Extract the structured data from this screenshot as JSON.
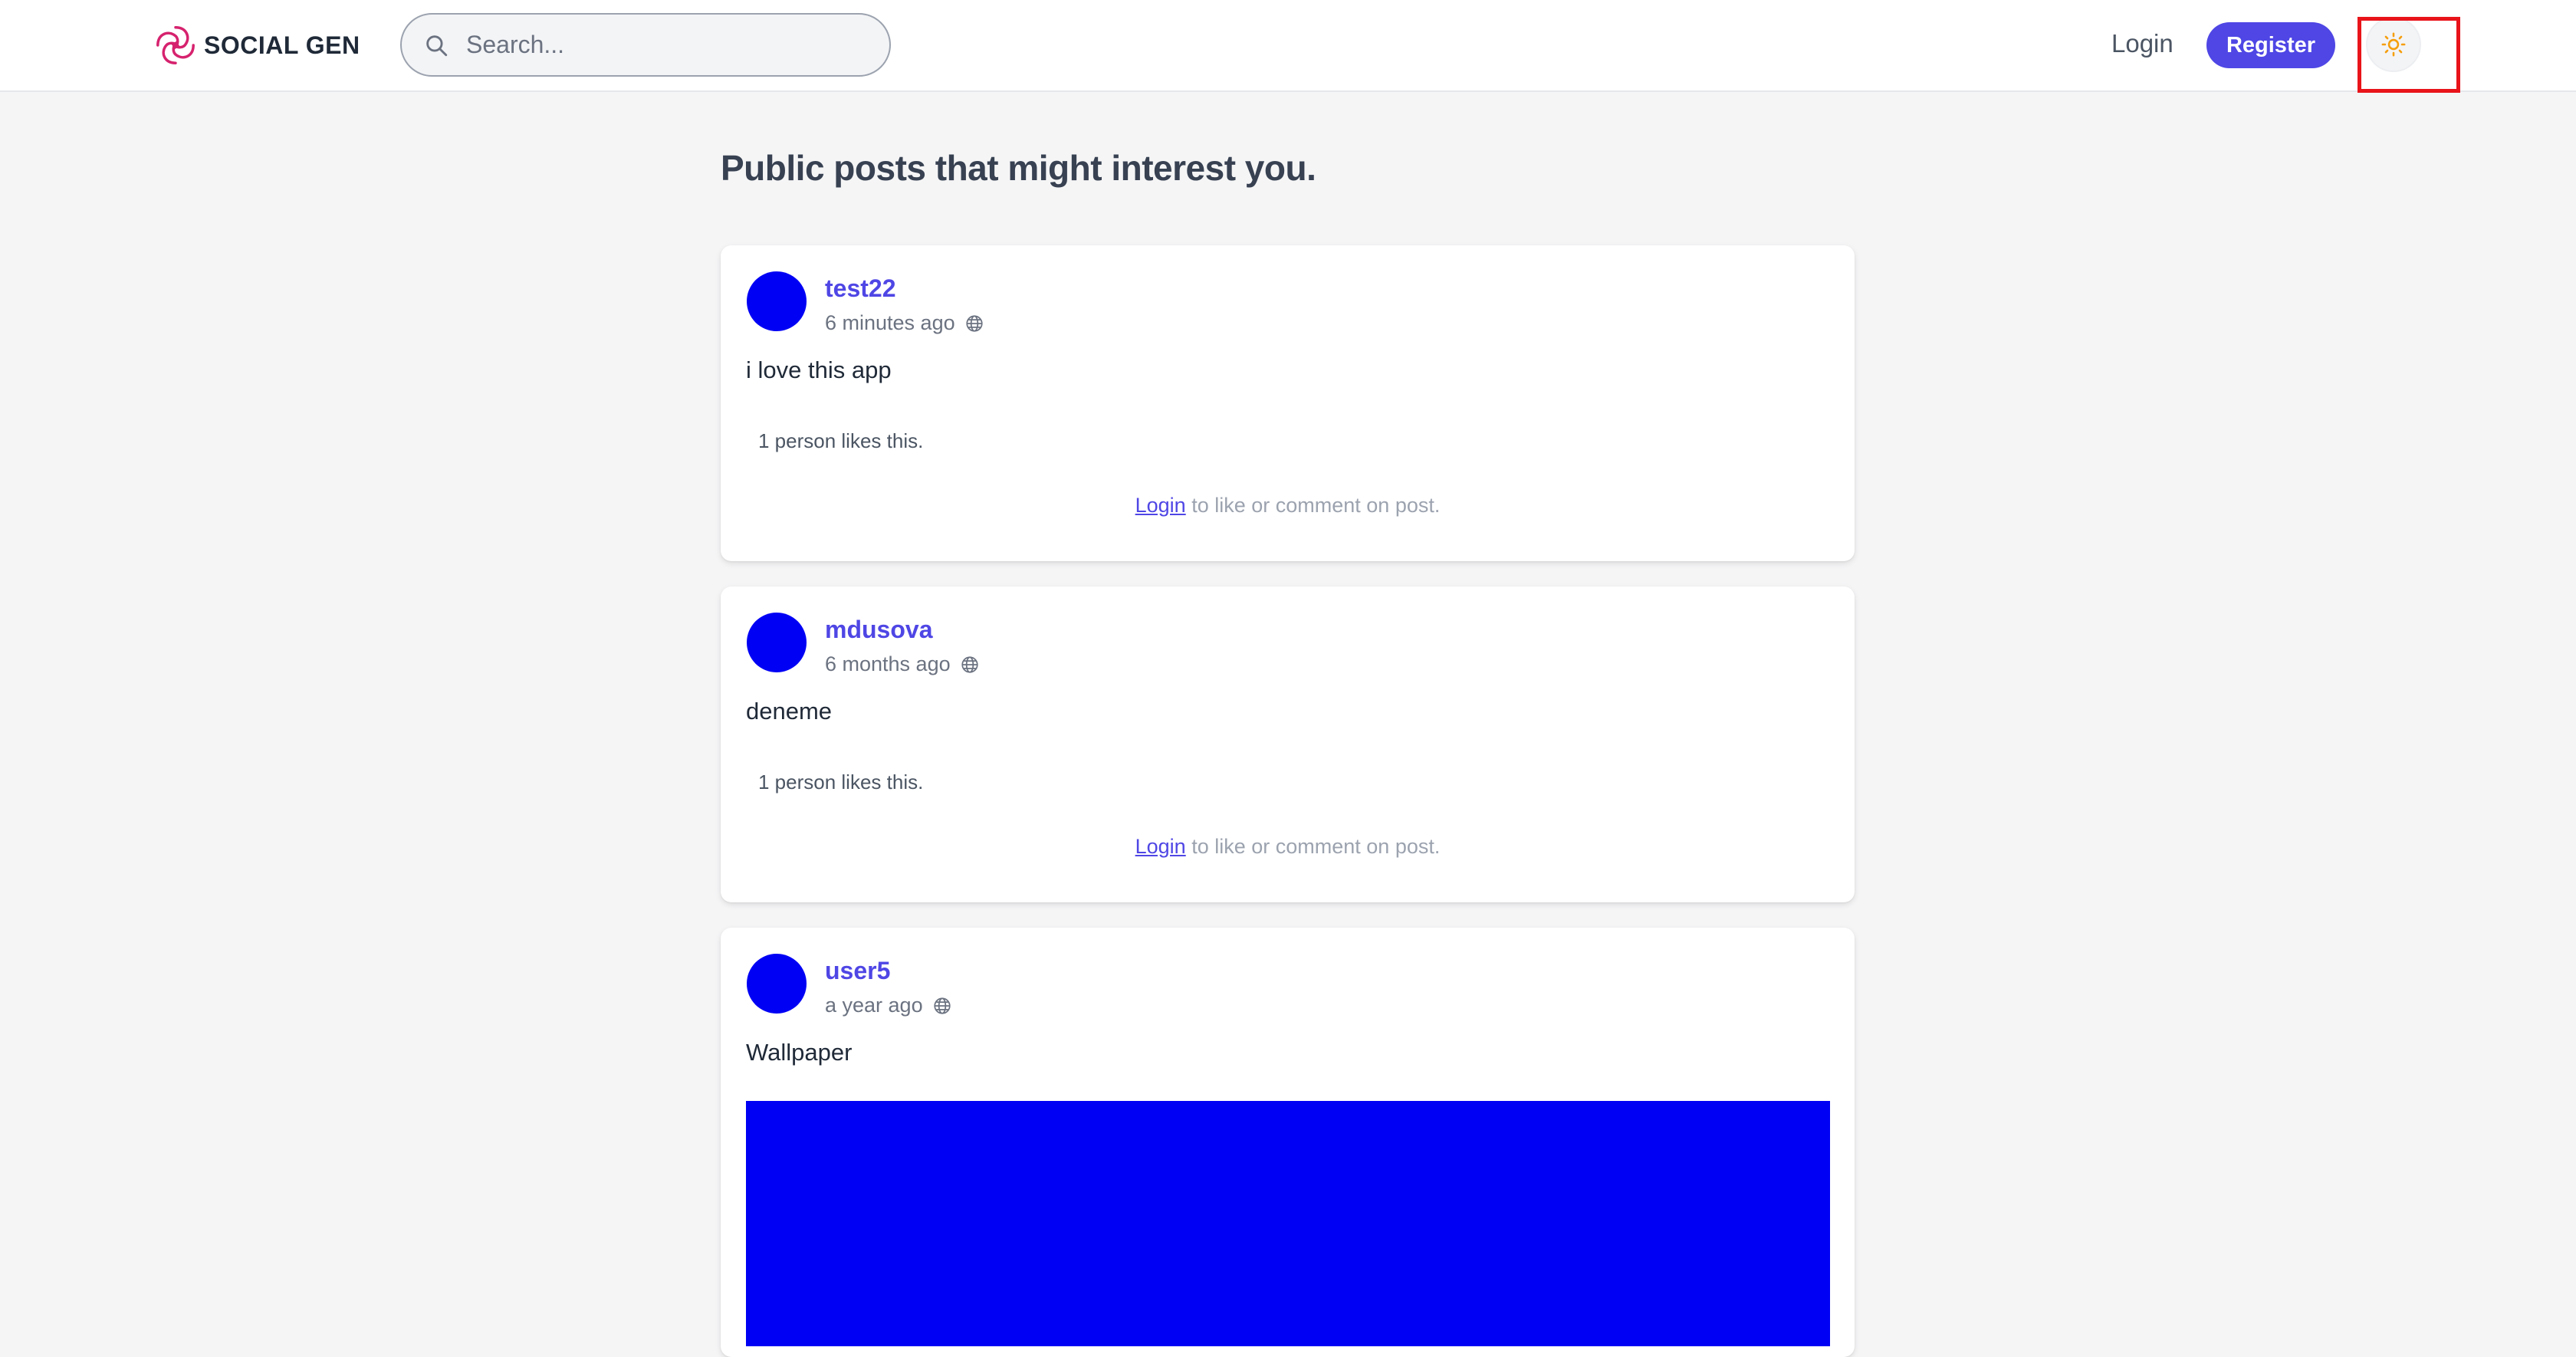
{
  "header": {
    "brand": "SOCIAL GEN",
    "search_placeholder": "Search...",
    "login_label": "Login",
    "register_label": "Register",
    "theme_icon": "sun-icon"
  },
  "colors": {
    "accent": "#4f46e5",
    "avatar": "#0000f5",
    "logo": "#d6226e",
    "sun": "#f59e0b",
    "highlight": "#e8141a"
  },
  "main": {
    "title": "Public posts that might interest you.",
    "cta_login": "Login",
    "cta_rest": " to like or comment on post.",
    "posts": [
      {
        "author": "test22",
        "time": "6 minutes ago",
        "visibility_icon": "globe-icon",
        "text": "i love this app",
        "likes": "1 person likes this.",
        "has_image": false
      },
      {
        "author": "mdusova",
        "time": "6 months ago",
        "visibility_icon": "globe-icon",
        "text": "deneme",
        "likes": "1 person likes this.",
        "has_image": false
      },
      {
        "author": "user5",
        "time": "a year ago",
        "visibility_icon": "globe-icon",
        "text": "Wallpaper",
        "has_image": true
      }
    ]
  }
}
